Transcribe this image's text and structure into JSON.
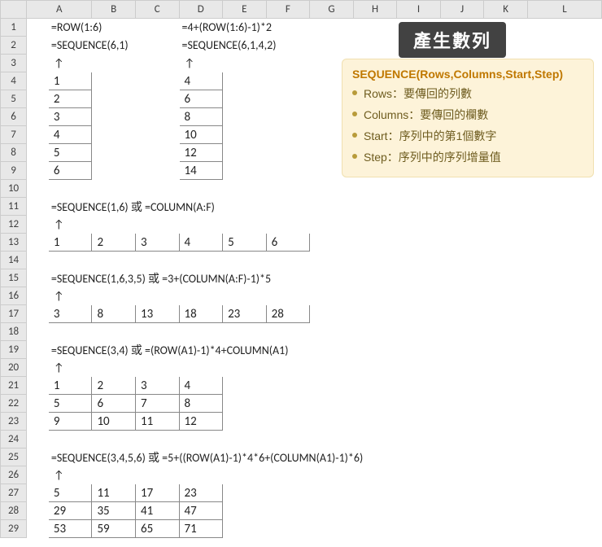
{
  "cols": [
    "A",
    "B",
    "C",
    "D",
    "E",
    "F",
    "G",
    "H",
    "I",
    "J",
    "K",
    "L"
  ],
  "rows": [
    "1",
    "2",
    "3",
    "4",
    "5",
    "6",
    "7",
    "8",
    "9",
    "10",
    "11",
    "12",
    "13",
    "14",
    "15",
    "16",
    "17",
    "18",
    "19",
    "20",
    "21",
    "22",
    "23",
    "24",
    "25",
    "26",
    "27",
    "28",
    "29"
  ],
  "title": "產生數列",
  "info": {
    "syntax": "SEQUENCE(Rows,Columns,Start,Step)",
    "items": [
      "Rows：要傳回的列數",
      "Columns：要傳回的欄數",
      "Start：序列中的第1個數字",
      "Step：序列中的序列增量值"
    ]
  },
  "f": {
    "b1": "=ROW(1:6)",
    "b2": "=SEQUENCE(6,1)",
    "e1": "=4+(ROW(1:6)-1)*2",
    "e2": "=SEQUENCE(6,1,4,2)",
    "b11": "=SEQUENCE(1,6) 或 =COLUMN(A:F)",
    "b15": "=SEQUENCE(1,6,3,5) 或 =3+(COLUMN(A:F)-1)*5",
    "b19": "=SEQUENCE(3,4) 或 =(ROW(A1)-1)*4+COLUMN(A1)",
    "b25": "=SEQUENCE(3,4,5,6) 或 =5+((ROW(A1)-1)*4*6+(COLUMN(A1)-1)*6)"
  },
  "chart_data": [
    {
      "type": "table",
      "title": "=SEQUENCE(6,1)",
      "values": [
        [
          1
        ],
        [
          2
        ],
        [
          3
        ],
        [
          4
        ],
        [
          5
        ],
        [
          6
        ]
      ]
    },
    {
      "type": "table",
      "title": "=SEQUENCE(6,1,4,2)",
      "values": [
        [
          4
        ],
        [
          6
        ],
        [
          8
        ],
        [
          10
        ],
        [
          12
        ],
        [
          14
        ]
      ]
    },
    {
      "type": "table",
      "title": "=SEQUENCE(1,6)",
      "values": [
        [
          1,
          2,
          3,
          4,
          5,
          6
        ]
      ]
    },
    {
      "type": "table",
      "title": "=SEQUENCE(1,6,3,5)",
      "values": [
        [
          3,
          8,
          13,
          18,
          23,
          28
        ]
      ]
    },
    {
      "type": "table",
      "title": "=SEQUENCE(3,4)",
      "values": [
        [
          1,
          2,
          3,
          4
        ],
        [
          5,
          6,
          7,
          8
        ],
        [
          9,
          10,
          11,
          12
        ]
      ]
    },
    {
      "type": "table",
      "title": "=SEQUENCE(3,4,5,6)",
      "values": [
        [
          5,
          11,
          17,
          23
        ],
        [
          29,
          35,
          41,
          47
        ],
        [
          53,
          59,
          65,
          71
        ]
      ]
    }
  ],
  "d": {
    "colA": [
      "1",
      "2",
      "3",
      "4",
      "5",
      "6"
    ],
    "colD": [
      "4",
      "6",
      "8",
      "10",
      "12",
      "14"
    ],
    "r13": [
      "1",
      "2",
      "3",
      "4",
      "5",
      "6"
    ],
    "r17": [
      "3",
      "8",
      "13",
      "18",
      "23",
      "28"
    ],
    "g21": [
      [
        "1",
        "2",
        "3",
        "4"
      ],
      [
        "5",
        "6",
        "7",
        "8"
      ],
      [
        "9",
        "10",
        "11",
        "12"
      ]
    ],
    "g27": [
      [
        "5",
        "11",
        "17",
        "23"
      ],
      [
        "29",
        "35",
        "41",
        "47"
      ],
      [
        "53",
        "59",
        "65",
        "71"
      ]
    ]
  },
  "arrow": "↑"
}
